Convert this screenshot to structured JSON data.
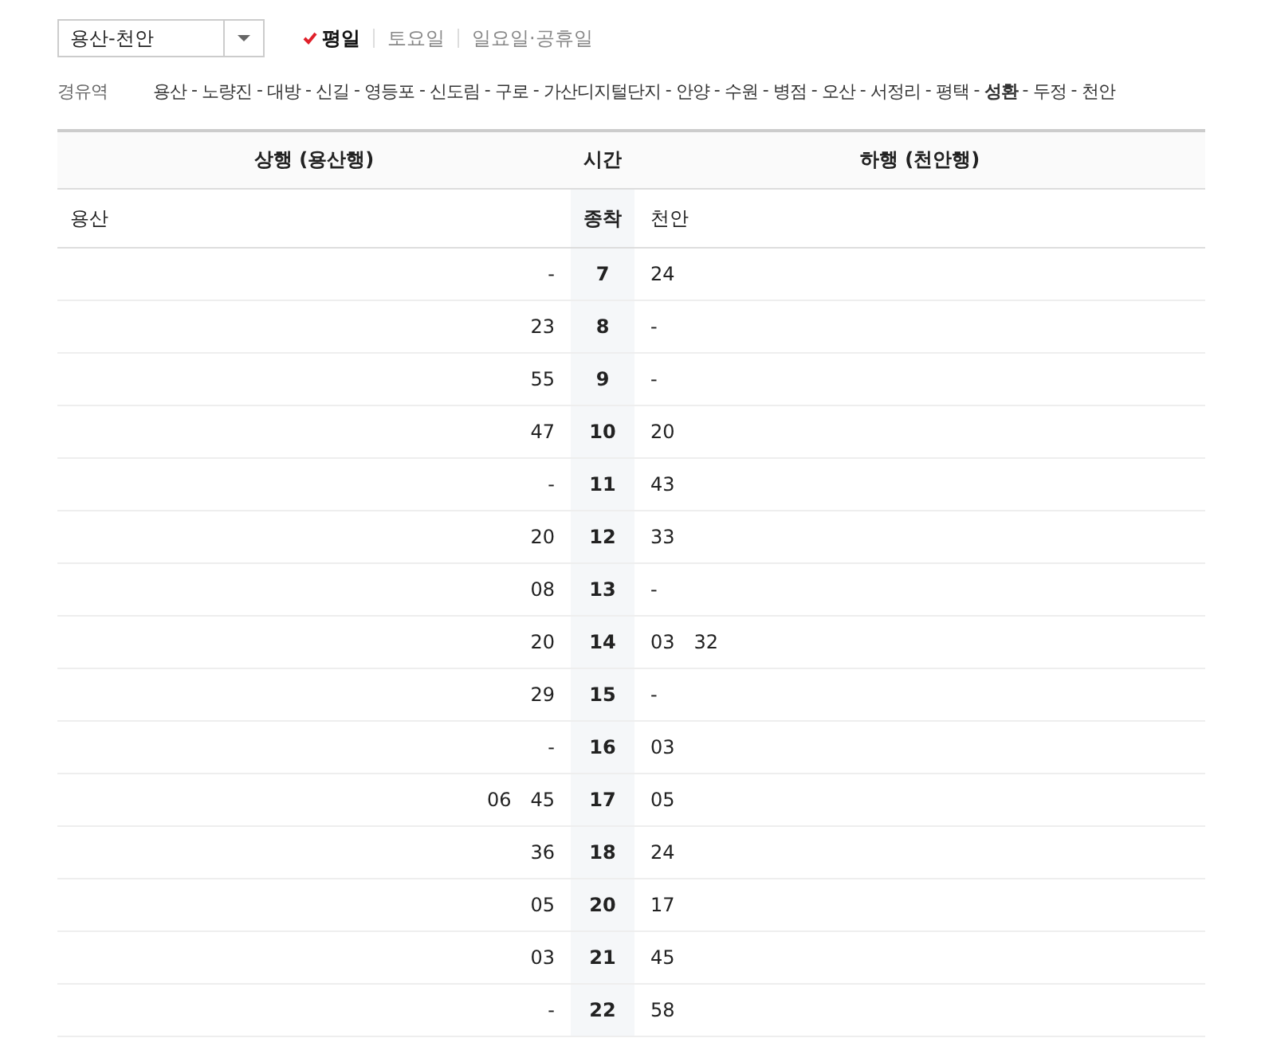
{
  "route_select": {
    "value": "용산-천안"
  },
  "day_tabs": [
    {
      "label": "평일",
      "selected": true
    },
    {
      "label": "토요일",
      "selected": false
    },
    {
      "label": "일요일·공휴일",
      "selected": false
    }
  ],
  "via": {
    "label": "경유역",
    "stations": [
      {
        "name": "용산",
        "emphasized": false
      },
      {
        "name": "노량진",
        "emphasized": false
      },
      {
        "name": "대방",
        "emphasized": false
      },
      {
        "name": "신길",
        "emphasized": false
      },
      {
        "name": "영등포",
        "emphasized": false
      },
      {
        "name": "신도림",
        "emphasized": false
      },
      {
        "name": "구로",
        "emphasized": false
      },
      {
        "name": "가산디지털단지",
        "emphasized": false
      },
      {
        "name": "안양",
        "emphasized": false
      },
      {
        "name": "수원",
        "emphasized": false
      },
      {
        "name": "병점",
        "emphasized": false
      },
      {
        "name": "오산",
        "emphasized": false
      },
      {
        "name": "서정리",
        "emphasized": false
      },
      {
        "name": "평택",
        "emphasized": false
      },
      {
        "name": "성환",
        "emphasized": true
      },
      {
        "name": "두정",
        "emphasized": false
      },
      {
        "name": "천안",
        "emphasized": false
      }
    ],
    "separator": "-"
  },
  "table": {
    "columns": [
      "상행 (용산행)",
      "시간",
      "하행 (천안행)"
    ],
    "subheader": [
      "용산",
      "종착",
      "천안"
    ],
    "rows": [
      {
        "hour": "7",
        "up": [
          "-"
        ],
        "down": [
          "24"
        ]
      },
      {
        "hour": "8",
        "up": [
          "23"
        ],
        "down": [
          "-"
        ]
      },
      {
        "hour": "9",
        "up": [
          "55"
        ],
        "down": [
          "-"
        ]
      },
      {
        "hour": "10",
        "up": [
          "47"
        ],
        "down": [
          "20"
        ]
      },
      {
        "hour": "11",
        "up": [
          "-"
        ],
        "down": [
          "43"
        ]
      },
      {
        "hour": "12",
        "up": [
          "20"
        ],
        "down": [
          "33"
        ]
      },
      {
        "hour": "13",
        "up": [
          "08"
        ],
        "down": [
          "-"
        ]
      },
      {
        "hour": "14",
        "up": [
          "20"
        ],
        "down": [
          "03",
          "32"
        ]
      },
      {
        "hour": "15",
        "up": [
          "29"
        ],
        "down": [
          "-"
        ]
      },
      {
        "hour": "16",
        "up": [
          "-"
        ],
        "down": [
          "03"
        ]
      },
      {
        "hour": "17",
        "up": [
          "06",
          "45"
        ],
        "down": [
          "05"
        ]
      },
      {
        "hour": "18",
        "up": [
          "36"
        ],
        "down": [
          "24"
        ]
      },
      {
        "hour": "20",
        "up": [
          "05"
        ],
        "down": [
          "17"
        ]
      },
      {
        "hour": "21",
        "up": [
          "03"
        ],
        "down": [
          "45"
        ]
      },
      {
        "hour": "22",
        "up": [
          "-"
        ],
        "down": [
          "58"
        ]
      }
    ]
  }
}
